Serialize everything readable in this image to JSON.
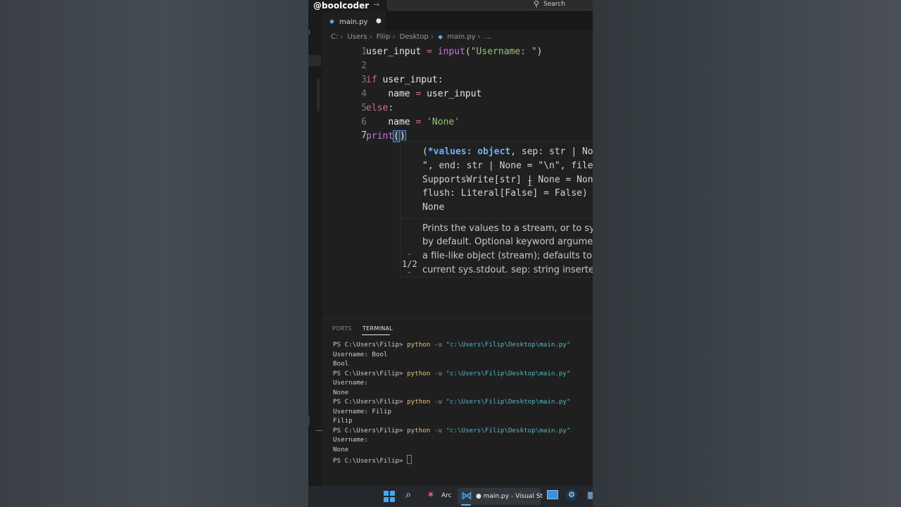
{
  "watermark": "@boolcoder",
  "titlebar": {
    "search_label": "Search"
  },
  "tab": {
    "label": "main.py",
    "dirty_mark": "●"
  },
  "breadcrumb": [
    "C:",
    "Users",
    "Filip",
    "Desktop",
    "main.py",
    "..."
  ],
  "editor": {
    "line_numbers": [
      "1",
      "2",
      "3",
      "4",
      "5",
      "6",
      "7"
    ],
    "active_line": 7,
    "lines": [
      "user_input = input(\"Username: \")",
      "",
      "if user_input:",
      "    name = user_input",
      "else:",
      "    name = 'None'",
      "print()"
    ]
  },
  "hover": {
    "signature_lines": [
      "(*values: object, sep: str | No",
      "\", end: str | None = \"\\n\", file",
      "SupportsWrite[str] | None = Non",
      "flush: Literal[False] = False) -",
      "None"
    ],
    "doc_lines": [
      "Prints the values to a stream, or to sys.",
      "by default. Optional keyword argumen",
      "a file-like object (stream); defaults to t",
      "current sys.stdout. sep: string inserted"
    ],
    "pager": "1/2"
  },
  "panel": {
    "tabs": [
      "PORTS",
      "TERMINAL"
    ],
    "active_tab": "TERMINAL",
    "prompt": "PS C:\\Users\\Filip>",
    "command": "python",
    "flag": "-u",
    "path": "\"c:\\Users\\Filip\\Desktop\\main.py\"",
    "output": [
      [
        "Username: Bool",
        "Bool"
      ],
      [
        "Username:",
        "None"
      ],
      [
        "Username: Filip",
        "Filip"
      ],
      [
        "Username:",
        "None"
      ]
    ]
  },
  "taskbar": {
    "arc_label": "Arc",
    "vscode_label": "● main.py - Visual St"
  },
  "colors": {
    "editor_bg": "#1f1f1f",
    "keyword": "#d16c8b",
    "function": "#c678dd",
    "string": "#98c379",
    "terminal_command": "#e5c07b",
    "terminal_path": "#56b6c2"
  }
}
